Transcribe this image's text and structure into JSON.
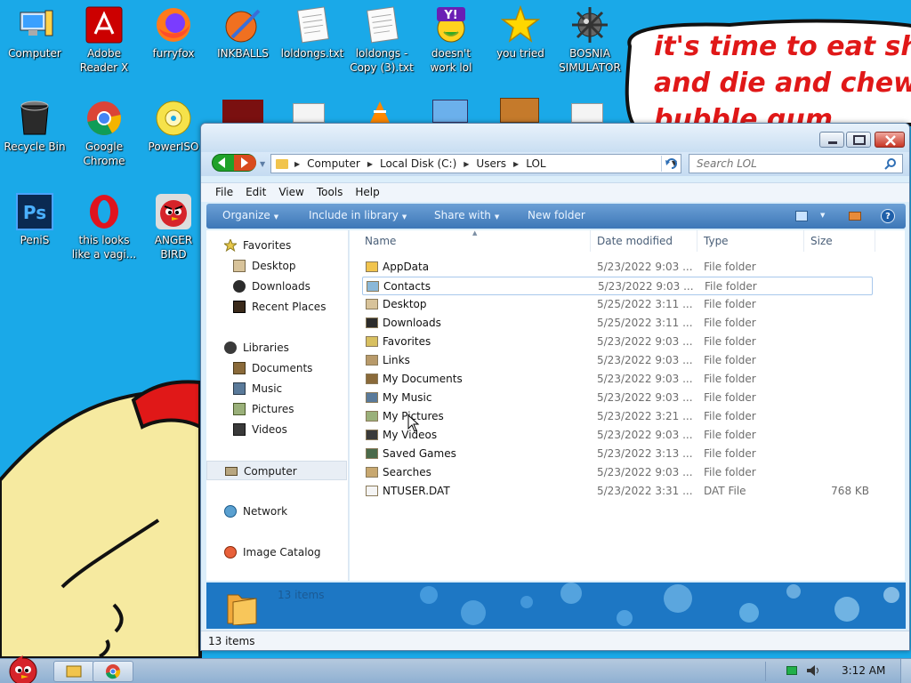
{
  "desktop": {
    "icons": [
      {
        "label": "Computer",
        "icon": "computer-icon"
      },
      {
        "label": "Adobe Reader X",
        "icon": "adobe-reader-icon"
      },
      {
        "label": "furryfox",
        "icon": "firefox-icon"
      },
      {
        "label": "INKBALLS",
        "icon": "inkball-icon"
      },
      {
        "label": "loldongs.txt",
        "icon": "text-file-icon"
      },
      {
        "label": "loldongs - Copy (3).txt",
        "icon": "text-file-icon"
      },
      {
        "label": "doesn't work lol",
        "icon": "yahoo-messenger-icon"
      },
      {
        "label": "you tried",
        "icon": "star-icon"
      },
      {
        "label": "BOSNIA SIMULATOR",
        "icon": "mine-icon"
      },
      {
        "label": "Recycle Bin",
        "icon": "recycle-bin-icon"
      },
      {
        "label": "Google Chrome",
        "icon": "chrome-icon"
      },
      {
        "label": "PowerISO",
        "icon": "poweriso-icon"
      },
      {
        "label": "PeniS",
        "icon": "photoshop-icon"
      },
      {
        "label": "this looks like a vagi...",
        "icon": "opera-icon"
      },
      {
        "label": "ANGER BIRD",
        "icon": "angry-birds-icon"
      }
    ],
    "speech_bubble_text": [
      "it's time to eat shit",
      "and die and chew",
      "bubble gum"
    ]
  },
  "window": {
    "address": {
      "crumbs": [
        "Computer",
        "Local Disk (C:)",
        "Users",
        "LOL"
      ]
    },
    "search": {
      "placeholder": "Search LOL"
    },
    "menu": [
      "File",
      "Edit",
      "View",
      "Tools",
      "Help"
    ],
    "commands": {
      "organize": "Organize",
      "include": "Include in library",
      "share": "Share with",
      "new_folder": "New folder"
    },
    "help_glyph": "?",
    "nav": {
      "favorites": {
        "header": "Favorites",
        "items": [
          "Desktop",
          "Downloads",
          "Recent Places"
        ]
      },
      "libraries": {
        "header": "Libraries",
        "items": [
          "Documents",
          "Music",
          "Pictures",
          "Videos"
        ]
      },
      "computer": "Computer",
      "network": "Network",
      "image_catalog": "Image Catalog"
    },
    "columns": {
      "name": "Name",
      "date": "Date modified",
      "type": "Type",
      "size": "Size"
    },
    "files": [
      {
        "name": "AppData",
        "date": "5/23/2022 9:03 ...",
        "type": "File folder",
        "size": "",
        "icon": "folder-icon"
      },
      {
        "name": "Contacts",
        "date": "5/23/2022 9:03 ...",
        "type": "File folder",
        "size": "",
        "icon": "contacts-icon"
      },
      {
        "name": "Desktop",
        "date": "5/25/2022 3:11 ...",
        "type": "File folder",
        "size": "",
        "icon": "desktop-folder-icon"
      },
      {
        "name": "Downloads",
        "date": "5/25/2022 3:11 ...",
        "type": "File folder",
        "size": "",
        "icon": "downloads-icon"
      },
      {
        "name": "Favorites",
        "date": "5/23/2022 9:03 ...",
        "type": "File folder",
        "size": "",
        "icon": "favorites-icon"
      },
      {
        "name": "Links",
        "date": "5/23/2022 9:03 ...",
        "type": "File folder",
        "size": "",
        "icon": "links-icon"
      },
      {
        "name": "My Documents",
        "date": "5/23/2022 9:03 ...",
        "type": "File folder",
        "size": "",
        "icon": "documents-icon"
      },
      {
        "name": "My Music",
        "date": "5/23/2022 9:03 ...",
        "type": "File folder",
        "size": "",
        "icon": "music-icon"
      },
      {
        "name": "My Pictures",
        "date": "5/23/2022 3:21 ...",
        "type": "File folder",
        "size": "",
        "icon": "pictures-icon"
      },
      {
        "name": "My Videos",
        "date": "5/23/2022 9:03 ...",
        "type": "File folder",
        "size": "",
        "icon": "videos-icon"
      },
      {
        "name": "Saved Games",
        "date": "5/23/2022 3:13 ...",
        "type": "File folder",
        "size": "",
        "icon": "saved-games-icon"
      },
      {
        "name": "Searches",
        "date": "5/23/2022 9:03 ...",
        "type": "File folder",
        "size": "",
        "icon": "searches-icon"
      },
      {
        "name": "NTUSER.DAT",
        "date": "5/23/2022 3:31 ...",
        "type": "DAT File",
        "size": "768 KB",
        "icon": "dat-file-icon"
      }
    ],
    "details_count": "13 items",
    "status": "13 items"
  },
  "taskbar": {
    "clock": "3:12 AM"
  }
}
